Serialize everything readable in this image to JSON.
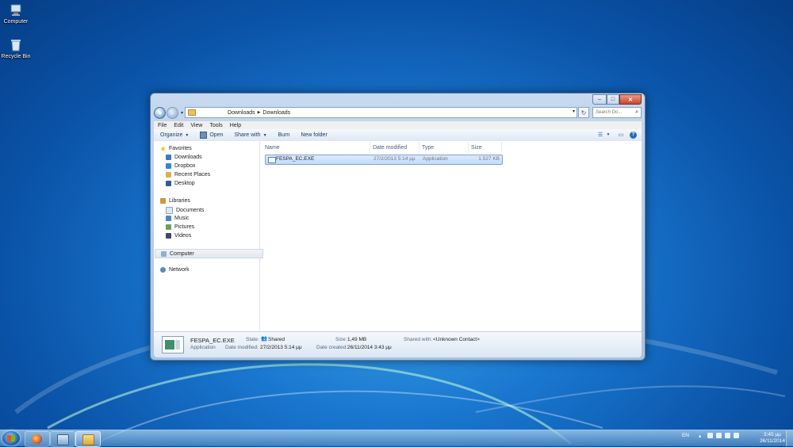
{
  "desktop": {
    "icons": [
      {
        "label": "Computer"
      },
      {
        "label": "Recycle Bin"
      }
    ]
  },
  "window": {
    "address": {
      "crumbs": [
        "Downloads",
        "Downloads"
      ]
    },
    "search": {
      "placeholder": "Search Do..."
    },
    "menu": [
      "File",
      "Edit",
      "View",
      "Tools",
      "Help"
    ],
    "toolbar": {
      "organize": "Organize",
      "open": "Open",
      "share_with": "Share with",
      "burn": "Burn",
      "new_folder": "New folder"
    },
    "nav": {
      "favorites": "Favorites",
      "favorites_items": [
        "Downloads",
        "Dropbox",
        "Recent Places",
        "Desktop"
      ],
      "libraries": "Libraries",
      "libraries_items": [
        "Documents",
        "Music",
        "Pictures",
        "Videos"
      ],
      "computer": "Computer",
      "network": "Network"
    },
    "columns": [
      "Name",
      "Date modified",
      "Type",
      "Size"
    ],
    "files": [
      {
        "name": "FESPA_EC.EXE",
        "date": "27/2/2013 5:14 μμ",
        "type": "Application",
        "size": "1.527 KB"
      }
    ],
    "details": {
      "name": "FESPA_EC.EXE",
      "type": "Application",
      "state_label": "State:",
      "state_value": "Shared",
      "size_label": "Size:",
      "size_value": "1,49 MB",
      "shared_label": "Shared with:",
      "shared_value": "<Unknown Contact>",
      "modified_label": "Date modified:",
      "modified_value": "27/2/2013 5:14 μμ",
      "created_label": "Date created:",
      "created_value": "26/11/2014 3:43 μμ"
    }
  },
  "taskbar": {
    "language": "EN",
    "time": "3:45 μμ",
    "date": "26/11/2014"
  },
  "colors": {
    "selection": "#c1dcfc",
    "taskbar": "#4682be"
  }
}
